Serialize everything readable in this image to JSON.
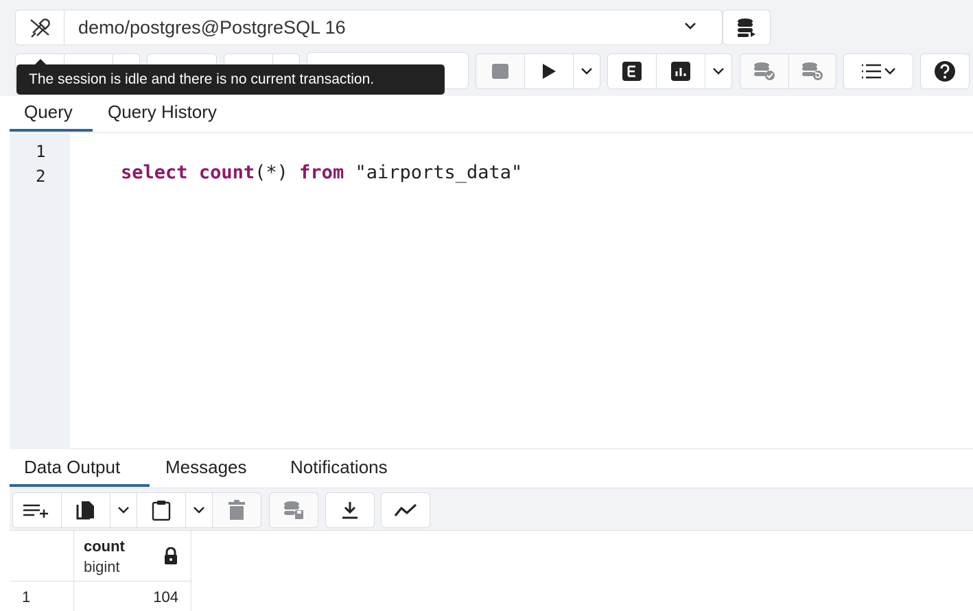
{
  "connection": {
    "label": "demo/postgres@PostgreSQL 16"
  },
  "tooltip": {
    "text": "The session is idle and there is no current transaction."
  },
  "icons": {
    "connection_status": "plug-disconnected-icon",
    "database": "database-icon",
    "stop": "stop-icon",
    "execute": "play-icon",
    "explain": "explain-icon",
    "explain_analyze": "explain-analyze-icon",
    "commit": "commit-icon",
    "rollback": "rollback-icon",
    "macros": "list-icon",
    "help": "help-icon",
    "add_row": "add-row-icon",
    "copy": "copy-icon",
    "paste": "paste-icon",
    "delete": "trash-icon",
    "save_data": "save-data-icon",
    "download": "download-icon",
    "graph": "graph-icon",
    "lock": "lock-icon"
  },
  "editor_tabs": [
    {
      "label": "Query",
      "active": true
    },
    {
      "label": "Query History",
      "active": false
    }
  ],
  "editor": {
    "line_numbers": [
      "1",
      "2"
    ],
    "line1": {
      "kw_select": "select",
      "fn_count": "count",
      "args": "(*)",
      "kw_from": "from",
      "table": "\"airports_data\""
    }
  },
  "output_tabs": [
    {
      "label": "Data Output",
      "active": true
    },
    {
      "label": "Messages",
      "active": false
    },
    {
      "label": "Notifications",
      "active": false
    }
  ],
  "grid": {
    "columns": [
      {
        "name": "count",
        "type": "bigint"
      }
    ],
    "rows": [
      {
        "row_number": "1",
        "cells": [
          "104"
        ]
      }
    ]
  },
  "colors": {
    "keyword": "#8a1a6e",
    "string": "#222222",
    "tab_active_underline": "#326690",
    "tooltip_bg": "#222222",
    "gutter_bg": "#eef1f5"
  }
}
